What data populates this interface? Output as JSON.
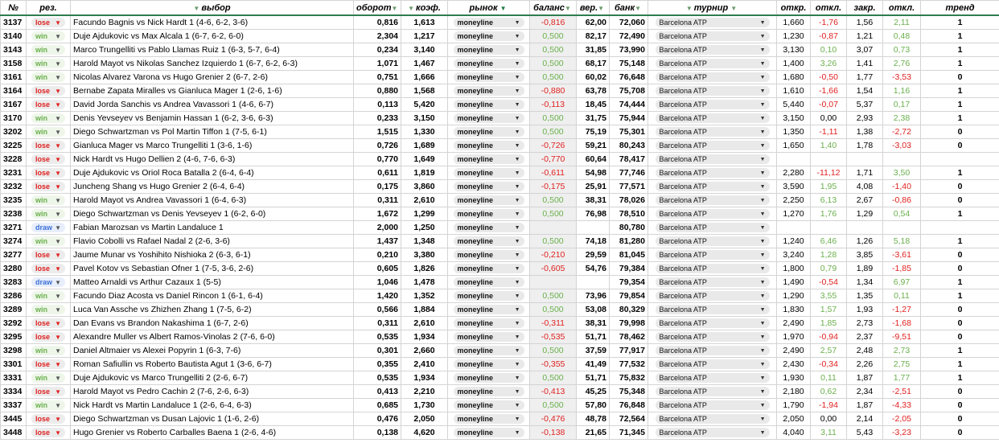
{
  "headers": {
    "id": "№",
    "res": "рез.",
    "pick": "выбор",
    "turnover": "оборот",
    "coef": "коэф.",
    "market": "рынок",
    "balance": "баланс",
    "prob": "вер.",
    "bank": "банк",
    "tournament": "турнир",
    "open": "откр.",
    "dev1": "откл.",
    "close": "закр.",
    "dev2": "откл.",
    "trend": "тренд"
  },
  "rows": [
    {
      "id": "3137",
      "res": "lose",
      "pick": "Facundo Bagnis vs Nick Hardt 1 (4-6, 6-2, 3-6)",
      "turnover": "0,816",
      "coef": "1,613",
      "market": "moneyline",
      "balance": "-0,816",
      "prob": "62,00",
      "bank": "72,060",
      "tournament": "Barcelona ATP",
      "open": "1,660",
      "dev1": "-1,76",
      "close": "1,56",
      "dev2": "2,11",
      "trend": "1"
    },
    {
      "id": "3140",
      "res": "win",
      "pick": "Duje Ajdukovic vs Max Alcala 1 (6-7, 6-2, 6-0)",
      "turnover": "2,304",
      "coef": "1,217",
      "market": "moneyline",
      "balance": "0,500",
      "prob": "82,17",
      "bank": "72,490",
      "tournament": "Barcelona ATP",
      "open": "1,230",
      "dev1": "-0,87",
      "close": "1,21",
      "dev2": "0,48",
      "trend": "1"
    },
    {
      "id": "3143",
      "res": "win",
      "pick": "Marco Trungelliti vs Pablo Llamas Ruiz 1 (6-3, 5-7, 6-4)",
      "turnover": "0,234",
      "coef": "3,140",
      "market": "moneyline",
      "balance": "0,500",
      "prob": "31,85",
      "bank": "73,990",
      "tournament": "Barcelona ATP",
      "open": "3,130",
      "dev1": "0,10",
      "close": "3,07",
      "dev2": "0,73",
      "trend": "1"
    },
    {
      "id": "3158",
      "res": "win",
      "pick": "Harold Mayot vs Nikolas Sanchez Izquierdo 1 (6-7, 6-2, 6-3)",
      "turnover": "1,071",
      "coef": "1,467",
      "market": "moneyline",
      "balance": "0,500",
      "prob": "68,17",
      "bank": "75,148",
      "tournament": "Barcelona ATP",
      "open": "1,400",
      "dev1": "3,26",
      "close": "1,41",
      "dev2": "2,76",
      "trend": "1"
    },
    {
      "id": "3161",
      "res": "win",
      "pick": "Nicolas Alvarez Varona vs Hugo Grenier 2 (6-7, 2-6)",
      "turnover": "0,751",
      "coef": "1,666",
      "market": "moneyline",
      "balance": "0,500",
      "prob": "60,02",
      "bank": "76,648",
      "tournament": "Barcelona ATP",
      "open": "1,680",
      "dev1": "-0,50",
      "close": "1,77",
      "dev2": "-3,53",
      "trend": "0"
    },
    {
      "id": "3164",
      "res": "lose",
      "pick": "Bernabe Zapata Miralles vs Gianluca Mager 1 (2-6, 1-6)",
      "turnover": "0,880",
      "coef": "1,568",
      "market": "moneyline",
      "balance": "-0,880",
      "prob": "63,78",
      "bank": "75,708",
      "tournament": "Barcelona ATP",
      "open": "1,610",
      "dev1": "-1,66",
      "close": "1,54",
      "dev2": "1,16",
      "trend": "1"
    },
    {
      "id": "3167",
      "res": "lose",
      "pick": "David Jorda Sanchis vs Andrea Vavassori 1 (4-6, 6-7)",
      "turnover": "0,113",
      "coef": "5,420",
      "market": "moneyline",
      "balance": "-0,113",
      "prob": "18,45",
      "bank": "74,444",
      "tournament": "Barcelona ATP",
      "open": "5,440",
      "dev1": "-0,07",
      "close": "5,37",
      "dev2": "0,17",
      "trend": "1"
    },
    {
      "id": "3170",
      "res": "win",
      "pick": "Denis Yevseyev vs Benjamin Hassan 1 (6-2, 3-6, 6-3)",
      "turnover": "0,233",
      "coef": "3,150",
      "market": "moneyline",
      "balance": "0,500",
      "prob": "31,75",
      "bank": "75,944",
      "tournament": "Barcelona ATP",
      "open": "3,150",
      "dev1": "0,00",
      "close": "2,93",
      "dev2": "2,38",
      "trend": "1"
    },
    {
      "id": "3202",
      "res": "win",
      "pick": "Diego Schwartzman vs Pol Martin Tiffon 1 (7-5, 6-1)",
      "turnover": "1,515",
      "coef": "1,330",
      "market": "moneyline",
      "balance": "0,500",
      "prob": "75,19",
      "bank": "75,301",
      "tournament": "Barcelona ATP",
      "open": "1,350",
      "dev1": "-1,11",
      "close": "1,38",
      "dev2": "-2,72",
      "trend": "0"
    },
    {
      "id": "3225",
      "res": "lose",
      "pick": "Gianluca Mager vs Marco Trungelliti 1 (3-6, 1-6)",
      "turnover": "0,726",
      "coef": "1,689",
      "market": "moneyline",
      "balance": "-0,726",
      "prob": "59,21",
      "bank": "80,243",
      "tournament": "Barcelona ATP",
      "open": "1,650",
      "dev1": "1,40",
      "close": "1,78",
      "dev2": "-3,03",
      "trend": "0"
    },
    {
      "id": "3228",
      "res": "lose",
      "pick": "Nick Hardt vs Hugo Dellien 2 (4-6, 7-6, 6-3)",
      "turnover": "0,770",
      "coef": "1,649",
      "market": "moneyline",
      "balance": "-0,770",
      "prob": "60,64",
      "bank": "78,417",
      "tournament": "Barcelona ATP",
      "open": "",
      "dev1": "",
      "close": "",
      "dev2": "",
      "trend": ""
    },
    {
      "id": "3231",
      "res": "lose",
      "pick": "Duje Ajdukovic vs Oriol Roca Batalla 2 (6-4, 6-4)",
      "turnover": "0,611",
      "coef": "1,819",
      "market": "moneyline",
      "balance": "-0,611",
      "prob": "54,98",
      "bank": "77,746",
      "tournament": "Barcelona ATP",
      "open": "2,280",
      "dev1": "-11,12",
      "close": "1,71",
      "dev2": "3,50",
      "trend": "1"
    },
    {
      "id": "3232",
      "res": "lose",
      "pick": "Juncheng Shang vs Hugo Grenier 2 (6-4, 6-4)",
      "turnover": "0,175",
      "coef": "3,860",
      "market": "moneyline",
      "balance": "-0,175",
      "prob": "25,91",
      "bank": "77,571",
      "tournament": "Barcelona ATP",
      "open": "3,590",
      "dev1": "1,95",
      "close": "4,08",
      "dev2": "-1,40",
      "trend": "0"
    },
    {
      "id": "3235",
      "res": "win",
      "pick": "Harold Mayot vs Andrea Vavassori 1 (6-4, 6-3)",
      "turnover": "0,311",
      "coef": "2,610",
      "market": "moneyline",
      "balance": "0,500",
      "prob": "38,31",
      "bank": "78,026",
      "tournament": "Barcelona ATP",
      "open": "2,250",
      "dev1": "6,13",
      "close": "2,67",
      "dev2": "-0,86",
      "trend": "0"
    },
    {
      "id": "3238",
      "res": "win",
      "pick": "Diego Schwartzman vs Denis Yevseyev 1 (6-2, 6-0)",
      "turnover": "1,672",
      "coef": "1,299",
      "market": "moneyline",
      "balance": "0,500",
      "prob": "76,98",
      "bank": "78,510",
      "tournament": "Barcelona ATP",
      "open": "1,270",
      "dev1": "1,76",
      "close": "1,29",
      "dev2": "0,54",
      "trend": "1"
    },
    {
      "id": "3271",
      "res": "draw",
      "pick": "Fabian Marozsan vs Martin Landaluce 1",
      "turnover": "2,000",
      "coef": "1,250",
      "market": "moneyline",
      "balance": "",
      "prob": "",
      "bank": "80,780",
      "tournament": "Barcelona ATP",
      "open": "",
      "dev1": "",
      "close": "",
      "dev2": "",
      "trend": ""
    },
    {
      "id": "3274",
      "res": "win",
      "pick": "Flavio Cobolli vs Rafael Nadal 2 (2-6, 3-6)",
      "turnover": "1,437",
      "coef": "1,348",
      "market": "moneyline",
      "balance": "0,500",
      "prob": "74,18",
      "bank": "81,280",
      "tournament": "Barcelona ATP",
      "open": "1,240",
      "dev1": "6,46",
      "close": "1,26",
      "dev2": "5,18",
      "trend": "1"
    },
    {
      "id": "3277",
      "res": "lose",
      "pick": "Jaume Munar vs Yoshihito Nishioka 2 (6-3, 6-1)",
      "turnover": "0,210",
      "coef": "3,380",
      "market": "moneyline",
      "balance": "-0,210",
      "prob": "29,59",
      "bank": "81,045",
      "tournament": "Barcelona ATP",
      "open": "3,240",
      "dev1": "1,28",
      "close": "3,85",
      "dev2": "-3,61",
      "trend": "0"
    },
    {
      "id": "3280",
      "res": "lose",
      "pick": "Pavel Kotov vs Sebastian Ofner 1 (7-5, 3-6, 2-6)",
      "turnover": "0,605",
      "coef": "1,826",
      "market": "moneyline",
      "balance": "-0,605",
      "prob": "54,76",
      "bank": "79,384",
      "tournament": "Barcelona ATP",
      "open": "1,800",
      "dev1": "0,79",
      "close": "1,89",
      "dev2": "-1,85",
      "trend": "0"
    },
    {
      "id": "3283",
      "res": "draw",
      "pick": "Matteo Arnaldi vs Arthur Cazaux 1 (5-5)",
      "turnover": "1,046",
      "coef": "1,478",
      "market": "moneyline",
      "balance": "",
      "prob": "",
      "bank": "79,354",
      "tournament": "Barcelona ATP",
      "open": "1,490",
      "dev1": "-0,54",
      "close": "1,34",
      "dev2": "6,97",
      "trend": "1"
    },
    {
      "id": "3286",
      "res": "win",
      "pick": "Facundo Diaz Acosta vs Daniel Rincon 1 (6-1, 6-4)",
      "turnover": "1,420",
      "coef": "1,352",
      "market": "moneyline",
      "balance": "0,500",
      "prob": "73,96",
      "bank": "79,854",
      "tournament": "Barcelona ATP",
      "open": "1,290",
      "dev1": "3,55",
      "close": "1,35",
      "dev2": "0,11",
      "trend": "1"
    },
    {
      "id": "3289",
      "res": "win",
      "pick": "Luca Van Assche vs Zhizhen Zhang 1 (7-5, 6-2)",
      "turnover": "0,566",
      "coef": "1,884",
      "market": "moneyline",
      "balance": "0,500",
      "prob": "53,08",
      "bank": "80,329",
      "tournament": "Barcelona ATP",
      "open": "1,830",
      "dev1": "1,57",
      "close": "1,93",
      "dev2": "-1,27",
      "trend": "0"
    },
    {
      "id": "3292",
      "res": "lose",
      "pick": "Dan Evans vs Brandon Nakashima 1 (6-7, 2-6)",
      "turnover": "0,311",
      "coef": "2,610",
      "market": "moneyline",
      "balance": "-0,311",
      "prob": "38,31",
      "bank": "79,998",
      "tournament": "Barcelona ATP",
      "open": "2,490",
      "dev1": "1,85",
      "close": "2,73",
      "dev2": "-1,68",
      "trend": "0"
    },
    {
      "id": "3295",
      "res": "lose",
      "pick": "Alexandre Muller vs Albert Ramos-Vinolas 2 (7-6, 6-0)",
      "turnover": "0,535",
      "coef": "1,934",
      "market": "moneyline",
      "balance": "-0,535",
      "prob": "51,71",
      "bank": "78,462",
      "tournament": "Barcelona ATP",
      "open": "1,970",
      "dev1": "-0,94",
      "close": "2,37",
      "dev2": "-9,51",
      "trend": "0"
    },
    {
      "id": "3298",
      "res": "win",
      "pick": "Daniel Altmaier vs Alexei Popyrin 1 (6-3, 7-6)",
      "turnover": "0,301",
      "coef": "2,660",
      "market": "moneyline",
      "balance": "0,500",
      "prob": "37,59",
      "bank": "77,917",
      "tournament": "Barcelona ATP",
      "open": "2,490",
      "dev1": "2,57",
      "close": "2,48",
      "dev2": "2,73",
      "trend": "1"
    },
    {
      "id": "3301",
      "res": "lose",
      "pick": "Roman Safiullin vs Roberto Bautista Agut 1 (3-6, 6-7)",
      "turnover": "0,355",
      "coef": "2,410",
      "market": "moneyline",
      "balance": "-0,355",
      "prob": "41,49",
      "bank": "77,532",
      "tournament": "Barcelona ATP",
      "open": "2,430",
      "dev1": "-0,34",
      "close": "2,26",
      "dev2": "2,75",
      "trend": "1"
    },
    {
      "id": "3331",
      "res": "win",
      "pick": "Duje Ajdukovic vs Marco Trungelliti 2 (2-6, 6-7)",
      "turnover": "0,535",
      "coef": "1,934",
      "market": "moneyline",
      "balance": "0,500",
      "prob": "51,71",
      "bank": "75,832",
      "tournament": "Barcelona ATP",
      "open": "1,930",
      "dev1": "0,11",
      "close": "1,87",
      "dev2": "1,77",
      "trend": "1"
    },
    {
      "id": "3334",
      "res": "lose",
      "pick": "Harold Mayot vs Pedro Cachin 2 (7-6, 2-6, 6-3)",
      "turnover": "0,413",
      "coef": "2,210",
      "market": "moneyline",
      "balance": "-0,413",
      "prob": "45,25",
      "bank": "75,348",
      "tournament": "Barcelona ATP",
      "open": "2,180",
      "dev1": "0,62",
      "close": "2,34",
      "dev2": "-2,51",
      "trend": "0"
    },
    {
      "id": "3337",
      "res": "win",
      "pick": "Nick Hardt vs Martin Landaluce 1 (2-6, 6-4, 6-3)",
      "turnover": "0,685",
      "coef": "1,730",
      "market": "moneyline",
      "balance": "0,500",
      "prob": "57,80",
      "bank": "76,848",
      "tournament": "Barcelona ATP",
      "open": "1,790",
      "dev1": "-1,94",
      "close": "1,87",
      "dev2": "-4,33",
      "trend": "0"
    },
    {
      "id": "3445",
      "res": "lose",
      "pick": "Diego Schwartzman vs Dusan Lajovic 1 (1-6, 2-6)",
      "turnover": "0,476",
      "coef": "2,050",
      "market": "moneyline",
      "balance": "-0,476",
      "prob": "48,78",
      "bank": "72,564",
      "tournament": "Barcelona ATP",
      "open": "2,050",
      "dev1": "0,00",
      "close": "2,14",
      "dev2": "-2,05",
      "trend": "0"
    },
    {
      "id": "3448",
      "res": "lose",
      "pick": "Hugo Grenier vs Roberto Carballes Baena 1 (2-6, 4-6)",
      "turnover": "0,138",
      "coef": "4,620",
      "market": "moneyline",
      "balance": "-0,138",
      "prob": "21,65",
      "bank": "71,345",
      "tournament": "Barcelona ATP",
      "open": "4,040",
      "dev1": "3,11",
      "close": "5,43",
      "dev2": "-3,23",
      "trend": "0"
    }
  ],
  "colors": {
    "win": "#6ab04c",
    "lose": "#e02020",
    "draw": "#3a6fd8",
    "header_border": "#2e7d4f"
  }
}
